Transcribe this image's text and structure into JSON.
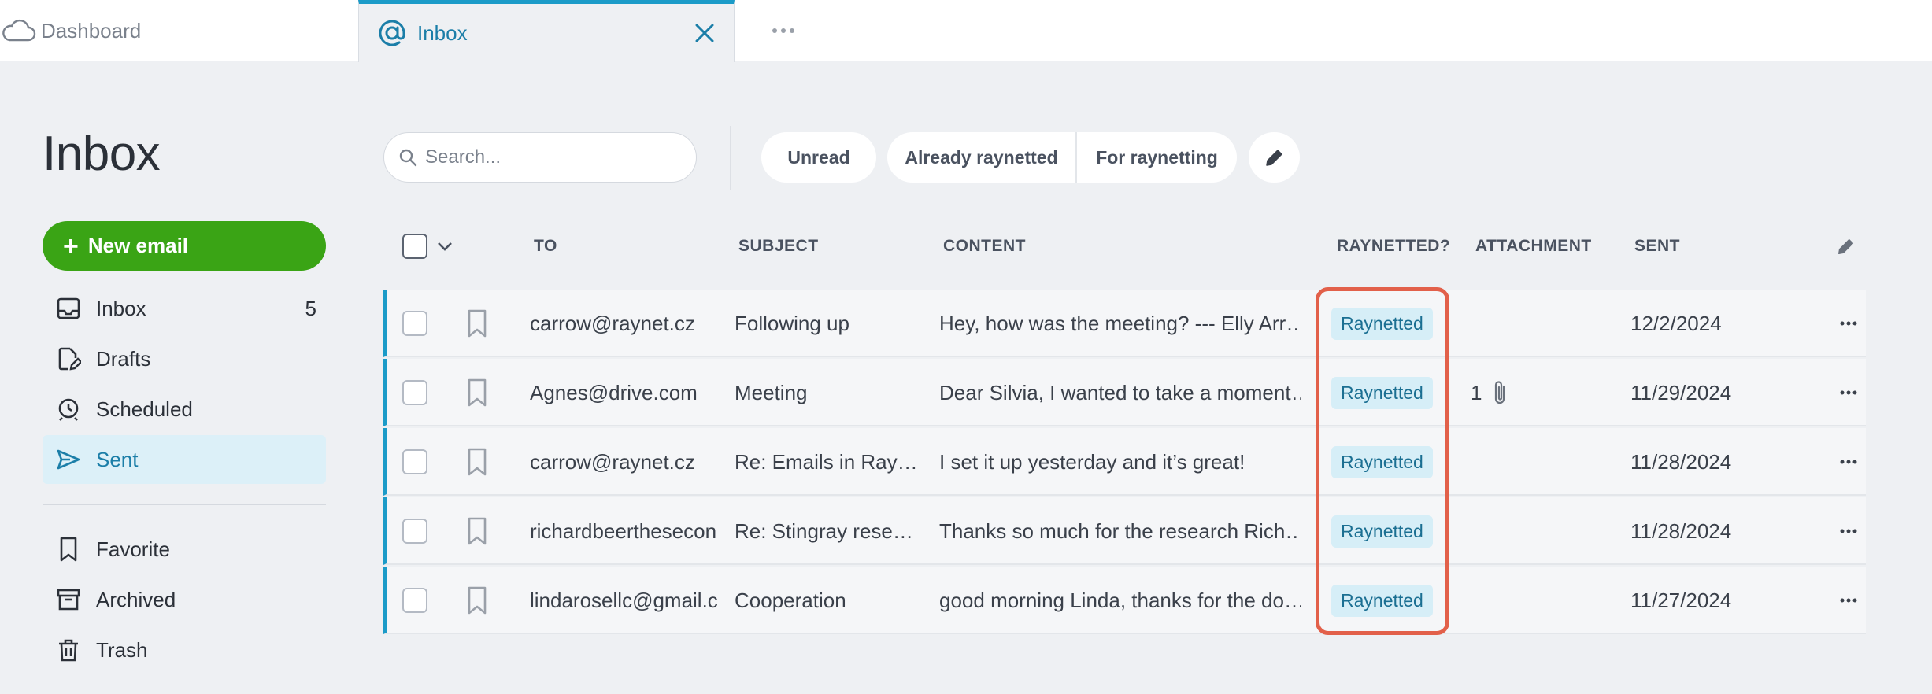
{
  "tabs": {
    "dashboard_label": "Dashboard",
    "inbox_label": "Inbox"
  },
  "page_title": "Inbox",
  "sidebar": {
    "new_email_label": "New email",
    "items": [
      {
        "label": "Inbox",
        "count": "5",
        "icon": "inbox-icon"
      },
      {
        "label": "Drafts",
        "icon": "drafts-icon"
      },
      {
        "label": "Scheduled",
        "icon": "scheduled-icon"
      },
      {
        "label": "Sent",
        "icon": "send-icon",
        "active": true
      },
      {
        "label": "Favorite",
        "icon": "bookmark-icon"
      },
      {
        "label": "Archived",
        "icon": "archive-icon"
      },
      {
        "label": "Trash",
        "icon": "trash-icon"
      }
    ]
  },
  "toolbar": {
    "search_placeholder": "Search...",
    "filter_unread": "Unread",
    "filter_already": "Already raynetted",
    "filter_for": "For raynetting"
  },
  "table": {
    "columns": [
      "TO",
      "SUBJECT",
      "CONTENT",
      "RAYNETTED?",
      "ATTACHMENT",
      "SENT"
    ],
    "rows": [
      {
        "to": "carrow@raynet.cz",
        "subject": "Following up",
        "content": "Hey, how was the meeting? --- Elly Arr…",
        "raynetted": "Raynetted",
        "attachment": "",
        "sent": "12/2/2024"
      },
      {
        "to": "Agnes@drive.com",
        "subject": "Meeting",
        "content": "Dear Silvia, I wanted to take a moment…",
        "raynetted": "Raynetted",
        "attachment": "1",
        "sent": "11/29/2024"
      },
      {
        "to": "carrow@raynet.cz",
        "subject": "Re: Emails in Ray…",
        "content": "I set it up yesterday and it’s great!",
        "raynetted": "Raynetted",
        "attachment": "",
        "sent": "11/28/2024"
      },
      {
        "to": "richardbeerthesecon",
        "subject": "Re: Stingray rese…",
        "content": "Thanks so much for the research Rich…",
        "raynetted": "Raynetted",
        "attachment": "",
        "sent": "11/28/2024"
      },
      {
        "to": "lindarosellc@gmail.c",
        "subject": "Cooperation",
        "content": "good morning Linda, thanks for the do…",
        "raynetted": "Raynetted",
        "attachment": "",
        "sent": "11/27/2024"
      }
    ]
  },
  "colors": {
    "accent": "#1b9bc8",
    "new_email_green": "#3aa415",
    "highlight_red": "#e2604a",
    "badge_bg": "#d6eef7"
  }
}
